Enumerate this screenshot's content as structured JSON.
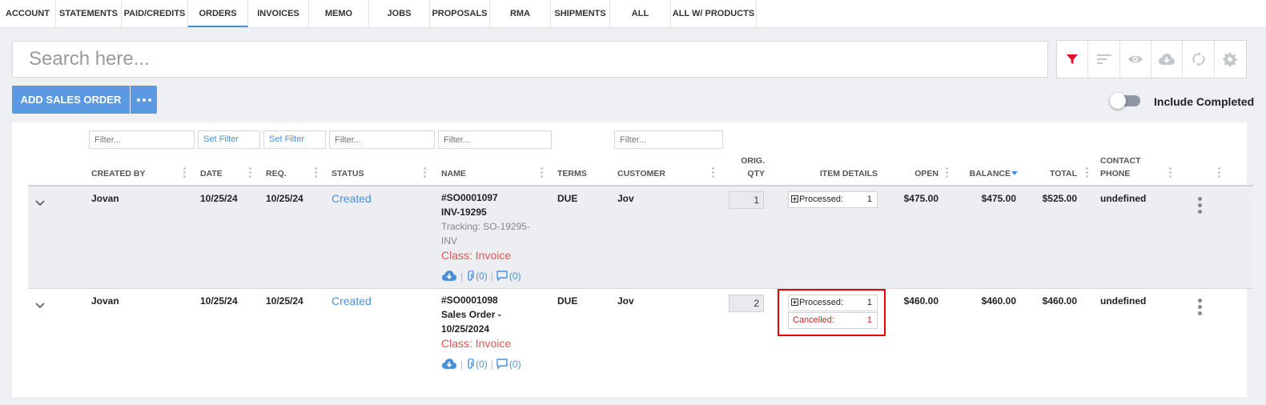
{
  "tabs": [
    {
      "label": "ACCOUNT",
      "active": false
    },
    {
      "label": "STATEMENTS",
      "active": false
    },
    {
      "label": "PAID/CREDITS",
      "active": false
    },
    {
      "label": "ORDERS",
      "active": true
    },
    {
      "label": "INVOICES",
      "active": false
    },
    {
      "label": "MEMO",
      "active": false
    },
    {
      "label": "JOBS",
      "active": false
    },
    {
      "label": "PROPOSALS",
      "active": false
    },
    {
      "label": "RMA",
      "active": false
    },
    {
      "label": "SHIPMENTS",
      "active": false
    },
    {
      "label": "ALL",
      "active": false
    },
    {
      "label": "ALL W/ PRODUCTS",
      "active": false
    }
  ],
  "search": {
    "placeholder": "Search here..."
  },
  "toolbar": {
    "icons": [
      "filter-icon",
      "sort-icon",
      "eye-icon",
      "cloud-download-icon",
      "sync-icon",
      "gear-icon"
    ],
    "active_color": "#e0102a"
  },
  "actions": {
    "add_label": "ADD SALES ORDER"
  },
  "toggle": {
    "label": "Include Completed",
    "on": false
  },
  "filters": {
    "created_by": "Filter...",
    "date": "Set Filter",
    "req": "Set Filter",
    "status": "Filter...",
    "name": "Filter...",
    "customer": "Filter..."
  },
  "columns": {
    "created_by": "CREATED BY",
    "date": "DATE",
    "req": "REQ.",
    "status": "STATUS",
    "name": "NAME",
    "terms": "TERMS",
    "customer": "CUSTOMER",
    "orig_qty_1": "ORIG.",
    "orig_qty_2": "QTY",
    "item_details": "ITEM DETAILS",
    "open": "OPEN",
    "balance": "BALANCE",
    "total": "TOTAL",
    "contact_1": "CONTACT",
    "contact_2": "PHONE"
  },
  "rows": [
    {
      "created_by": "Jovan",
      "date": "10/25/24",
      "req": "10/25/24",
      "status": "Created",
      "name_1": "#SO0001097",
      "name_2": "INV-19295",
      "tracking_1": "Tracking: SO-19295-",
      "tracking_2": "INV",
      "class": "Class: Invoice",
      "attachments": "(0)",
      "comments": "(0)",
      "terms": "DUE",
      "customer": "Jov",
      "orig_qty": "1",
      "processed_label": "Processed:",
      "processed_count": "1",
      "open": "$475.00",
      "balance": "$475.00",
      "total": "$525.00",
      "contact_phone": "undefined"
    },
    {
      "created_by": "Jovan",
      "date": "10/25/24",
      "req": "10/25/24",
      "status": "Created",
      "name_1": "#SO0001098",
      "name_2": "Sales Order -",
      "name_3": "10/25/2024",
      "class": "Class: Invoice",
      "attachments": "(0)",
      "comments": "(0)",
      "terms": "DUE",
      "customer": "Jov",
      "orig_qty": "2",
      "processed_label": "Processed:",
      "processed_count": "1",
      "cancelled_label": "Cancelled:",
      "cancelled_count": "1",
      "open": "$460.00",
      "balance": "$460.00",
      "total": "$460.00",
      "contact_phone": "undefined"
    }
  ]
}
